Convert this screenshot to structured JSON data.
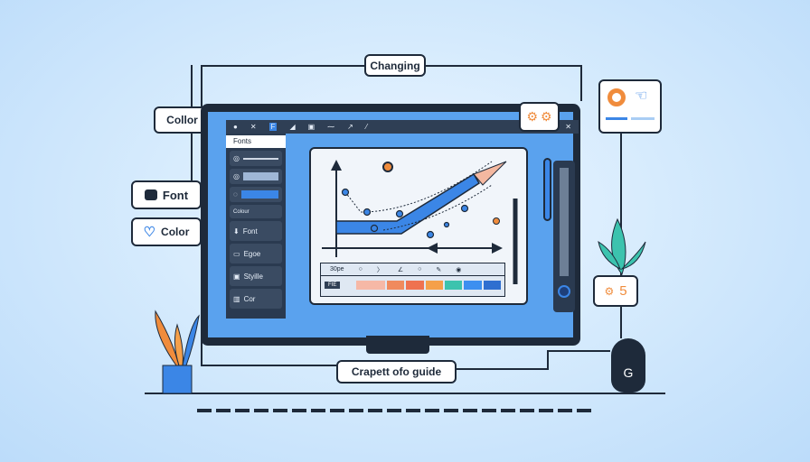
{
  "labels": {
    "top": "Changing",
    "collor": "Collor",
    "font": "Font",
    "color": "Color",
    "bottom": "Crapett ofo guide"
  },
  "toolbar": {
    "icons": [
      "pin-icon",
      "close-icon",
      "format-icon",
      "eraser-icon",
      "copy-icon",
      "text-icon",
      "path-icon",
      "pen-icon"
    ],
    "close": "✕"
  },
  "panel": {
    "header": "Fonts",
    "items": [
      {
        "label": "Font",
        "icon": "arrow-down-icon"
      },
      {
        "label": "Egoe",
        "icon": "folder-icon"
      },
      {
        "label": "Styille",
        "icon": "image-icon"
      },
      {
        "label": "Cor",
        "icon": "columns-icon"
      }
    ],
    "slider_label": "Colour"
  },
  "canvas": {
    "toolbar_label": "30pe",
    "palette_label": "FIE",
    "palette": [
      "#f6b8a6",
      "#f08a5d",
      "#ef7250",
      "#f5a04a",
      "#3cc3ae",
      "#3d8ff0",
      "#2f6fd0"
    ]
  },
  "badge": {
    "value": "5"
  },
  "colors": {
    "accent": "#3b86e6",
    "dark": "#1e2a3a",
    "orange": "#f08c3c",
    "teal": "#3cc3ae"
  }
}
